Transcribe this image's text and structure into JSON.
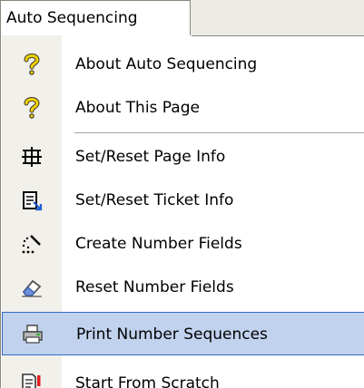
{
  "menu": {
    "title": "Auto Sequencing",
    "items": [
      {
        "label": "About Auto Sequencing",
        "icon": "question-mark-icon"
      },
      {
        "label": "About This Page",
        "icon": "question-mark-icon"
      },
      {
        "label": "Set/Reset Page Info",
        "icon": "page-frame-icon"
      },
      {
        "label": "Set/Reset Ticket Info",
        "icon": "ticket-export-icon"
      },
      {
        "label": "Create Number Fields",
        "icon": "wand-icon"
      },
      {
        "label": "Reset Number Fields",
        "icon": "eraser-icon"
      },
      {
        "label": "Print Number Sequences",
        "icon": "printer-icon",
        "highlighted": true
      },
      {
        "label": "Start From Scratch",
        "icon": "document-alert-icon"
      }
    ]
  },
  "colors": {
    "highlight_bg": "#c1d2ee",
    "highlight_border": "#316ac5",
    "gutter": "#f2f0ea"
  }
}
